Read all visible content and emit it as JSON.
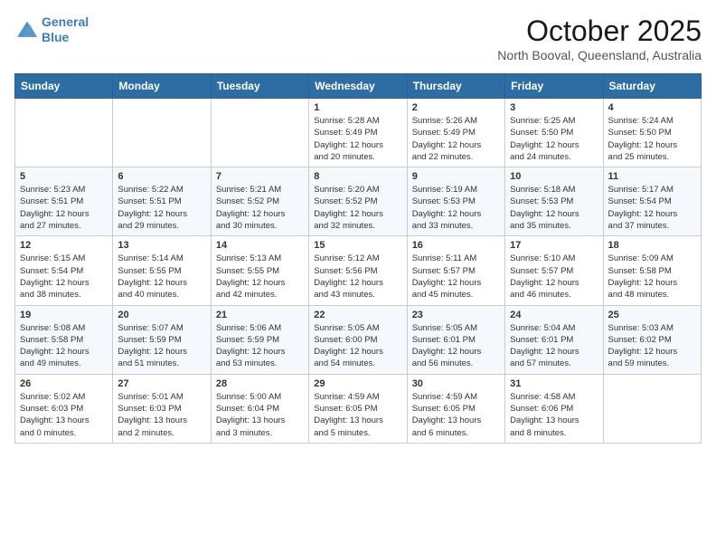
{
  "header": {
    "logo_line1": "General",
    "logo_line2": "Blue",
    "month": "October 2025",
    "location": "North Booval, Queensland, Australia"
  },
  "weekdays": [
    "Sunday",
    "Monday",
    "Tuesday",
    "Wednesday",
    "Thursday",
    "Friday",
    "Saturday"
  ],
  "weeks": [
    [
      {
        "day": "",
        "info": ""
      },
      {
        "day": "",
        "info": ""
      },
      {
        "day": "",
        "info": ""
      },
      {
        "day": "1",
        "info": "Sunrise: 5:28 AM\nSunset: 5:49 PM\nDaylight: 12 hours\nand 20 minutes."
      },
      {
        "day": "2",
        "info": "Sunrise: 5:26 AM\nSunset: 5:49 PM\nDaylight: 12 hours\nand 22 minutes."
      },
      {
        "day": "3",
        "info": "Sunrise: 5:25 AM\nSunset: 5:50 PM\nDaylight: 12 hours\nand 24 minutes."
      },
      {
        "day": "4",
        "info": "Sunrise: 5:24 AM\nSunset: 5:50 PM\nDaylight: 12 hours\nand 25 minutes."
      }
    ],
    [
      {
        "day": "5",
        "info": "Sunrise: 5:23 AM\nSunset: 5:51 PM\nDaylight: 12 hours\nand 27 minutes."
      },
      {
        "day": "6",
        "info": "Sunrise: 5:22 AM\nSunset: 5:51 PM\nDaylight: 12 hours\nand 29 minutes."
      },
      {
        "day": "7",
        "info": "Sunrise: 5:21 AM\nSunset: 5:52 PM\nDaylight: 12 hours\nand 30 minutes."
      },
      {
        "day": "8",
        "info": "Sunrise: 5:20 AM\nSunset: 5:52 PM\nDaylight: 12 hours\nand 32 minutes."
      },
      {
        "day": "9",
        "info": "Sunrise: 5:19 AM\nSunset: 5:53 PM\nDaylight: 12 hours\nand 33 minutes."
      },
      {
        "day": "10",
        "info": "Sunrise: 5:18 AM\nSunset: 5:53 PM\nDaylight: 12 hours\nand 35 minutes."
      },
      {
        "day": "11",
        "info": "Sunrise: 5:17 AM\nSunset: 5:54 PM\nDaylight: 12 hours\nand 37 minutes."
      }
    ],
    [
      {
        "day": "12",
        "info": "Sunrise: 5:15 AM\nSunset: 5:54 PM\nDaylight: 12 hours\nand 38 minutes."
      },
      {
        "day": "13",
        "info": "Sunrise: 5:14 AM\nSunset: 5:55 PM\nDaylight: 12 hours\nand 40 minutes."
      },
      {
        "day": "14",
        "info": "Sunrise: 5:13 AM\nSunset: 5:55 PM\nDaylight: 12 hours\nand 42 minutes."
      },
      {
        "day": "15",
        "info": "Sunrise: 5:12 AM\nSunset: 5:56 PM\nDaylight: 12 hours\nand 43 minutes."
      },
      {
        "day": "16",
        "info": "Sunrise: 5:11 AM\nSunset: 5:57 PM\nDaylight: 12 hours\nand 45 minutes."
      },
      {
        "day": "17",
        "info": "Sunrise: 5:10 AM\nSunset: 5:57 PM\nDaylight: 12 hours\nand 46 minutes."
      },
      {
        "day": "18",
        "info": "Sunrise: 5:09 AM\nSunset: 5:58 PM\nDaylight: 12 hours\nand 48 minutes."
      }
    ],
    [
      {
        "day": "19",
        "info": "Sunrise: 5:08 AM\nSunset: 5:58 PM\nDaylight: 12 hours\nand 49 minutes."
      },
      {
        "day": "20",
        "info": "Sunrise: 5:07 AM\nSunset: 5:59 PM\nDaylight: 12 hours\nand 51 minutes."
      },
      {
        "day": "21",
        "info": "Sunrise: 5:06 AM\nSunset: 5:59 PM\nDaylight: 12 hours\nand 53 minutes."
      },
      {
        "day": "22",
        "info": "Sunrise: 5:05 AM\nSunset: 6:00 PM\nDaylight: 12 hours\nand 54 minutes."
      },
      {
        "day": "23",
        "info": "Sunrise: 5:05 AM\nSunset: 6:01 PM\nDaylight: 12 hours\nand 56 minutes."
      },
      {
        "day": "24",
        "info": "Sunrise: 5:04 AM\nSunset: 6:01 PM\nDaylight: 12 hours\nand 57 minutes."
      },
      {
        "day": "25",
        "info": "Sunrise: 5:03 AM\nSunset: 6:02 PM\nDaylight: 12 hours\nand 59 minutes."
      }
    ],
    [
      {
        "day": "26",
        "info": "Sunrise: 5:02 AM\nSunset: 6:03 PM\nDaylight: 13 hours\nand 0 minutes."
      },
      {
        "day": "27",
        "info": "Sunrise: 5:01 AM\nSunset: 6:03 PM\nDaylight: 13 hours\nand 2 minutes."
      },
      {
        "day": "28",
        "info": "Sunrise: 5:00 AM\nSunset: 6:04 PM\nDaylight: 13 hours\nand 3 minutes."
      },
      {
        "day": "29",
        "info": "Sunrise: 4:59 AM\nSunset: 6:05 PM\nDaylight: 13 hours\nand 5 minutes."
      },
      {
        "day": "30",
        "info": "Sunrise: 4:59 AM\nSunset: 6:05 PM\nDaylight: 13 hours\nand 6 minutes."
      },
      {
        "day": "31",
        "info": "Sunrise: 4:58 AM\nSunset: 6:06 PM\nDaylight: 13 hours\nand 8 minutes."
      },
      {
        "day": "",
        "info": ""
      }
    ]
  ]
}
